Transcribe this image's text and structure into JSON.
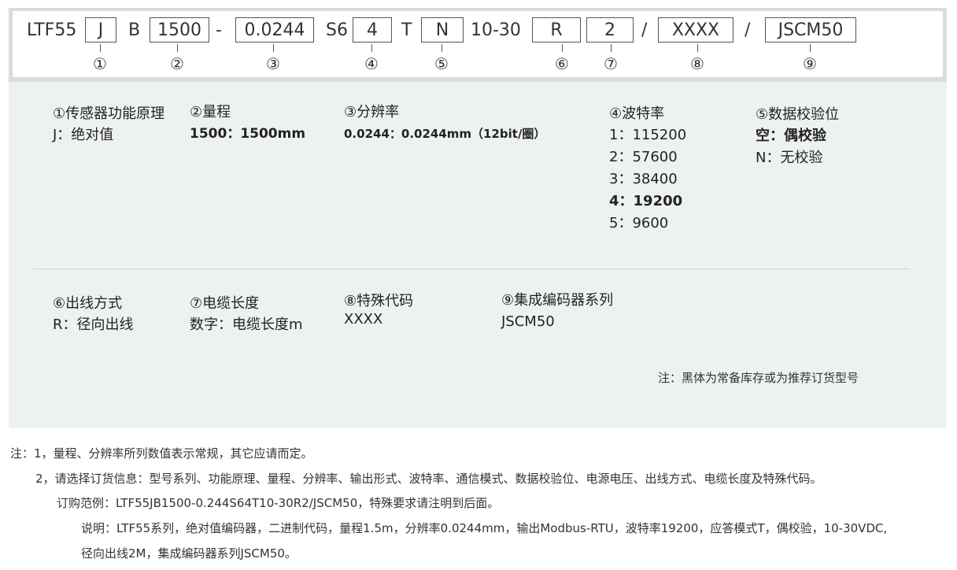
{
  "code": {
    "prefix": "LTF55",
    "f1": "J",
    "t_b": "B",
    "f2": "1500",
    "dash": "-",
    "f3": "0.0244",
    "t_s6": "S6",
    "f4": "4",
    "t_t": "T",
    "f5": "N",
    "t_volt": "10-30",
    "f6": "R",
    "f7": "2",
    "slash1": "/",
    "f8": "XXXX",
    "slash2": "/",
    "f9": "JSCM50",
    "markers": [
      "①",
      "②",
      "③",
      "④",
      "⑤",
      "⑥",
      "⑦",
      "⑧",
      "⑨"
    ]
  },
  "sections": {
    "s1": {
      "title": "①传感器功能原理",
      "lines": [
        "J：绝对值"
      ]
    },
    "s2": {
      "title": "②量程",
      "lines": [
        "1500：1500mm"
      ]
    },
    "s3": {
      "title": "③分辨率",
      "lines": [
        "0.0244：0.0244mm（12bit/圈）"
      ]
    },
    "s4": {
      "title": "④波特率",
      "lines": [
        "1：115200",
        "2：57600",
        "3：38400",
        "4：19200",
        "5：9600"
      ]
    },
    "s5": {
      "title": "⑤数据校验位",
      "lines": [
        "空：偶校验",
        "N：无校验"
      ]
    },
    "s6": {
      "title": "⑥出线方式",
      "lines": [
        "R：径向出线"
      ]
    },
    "s7": {
      "title": "⑦电缆长度",
      "lines": [
        "数字：电缆长度m"
      ]
    },
    "s8": {
      "title": "⑧特殊代码",
      "lines": [
        "XXXX"
      ]
    },
    "s9": {
      "title": "⑨集成编码器系列",
      "lines": [
        "JSCM50"
      ]
    }
  },
  "panel_note": "注：黑体为常备库存或为推荐订货型号",
  "notes": [
    "注：1，量程、分辨率所列数值表示常规，其它应请而定。",
    "2，请选择订货信息：型号系列、功能原理、量程、分辨率、输出形式、波特率、通信模式、数据校验位、电源电压、出线方式、电缆长度及特殊代码。",
    "订购范例：LTF55JB1500-0.244S64T10-30R2/JSCM50，特殊要求请注明到后面。",
    "说明：LTF55系列，绝对值编码器，二进制代码，量程1.5m，分辨率0.0244mm，输出Modbus-RTU，波特率19200，应答模式T，偶校验，10-30VDC,",
    "径向出线2M，集成编码器系列JSCM50。"
  ]
}
